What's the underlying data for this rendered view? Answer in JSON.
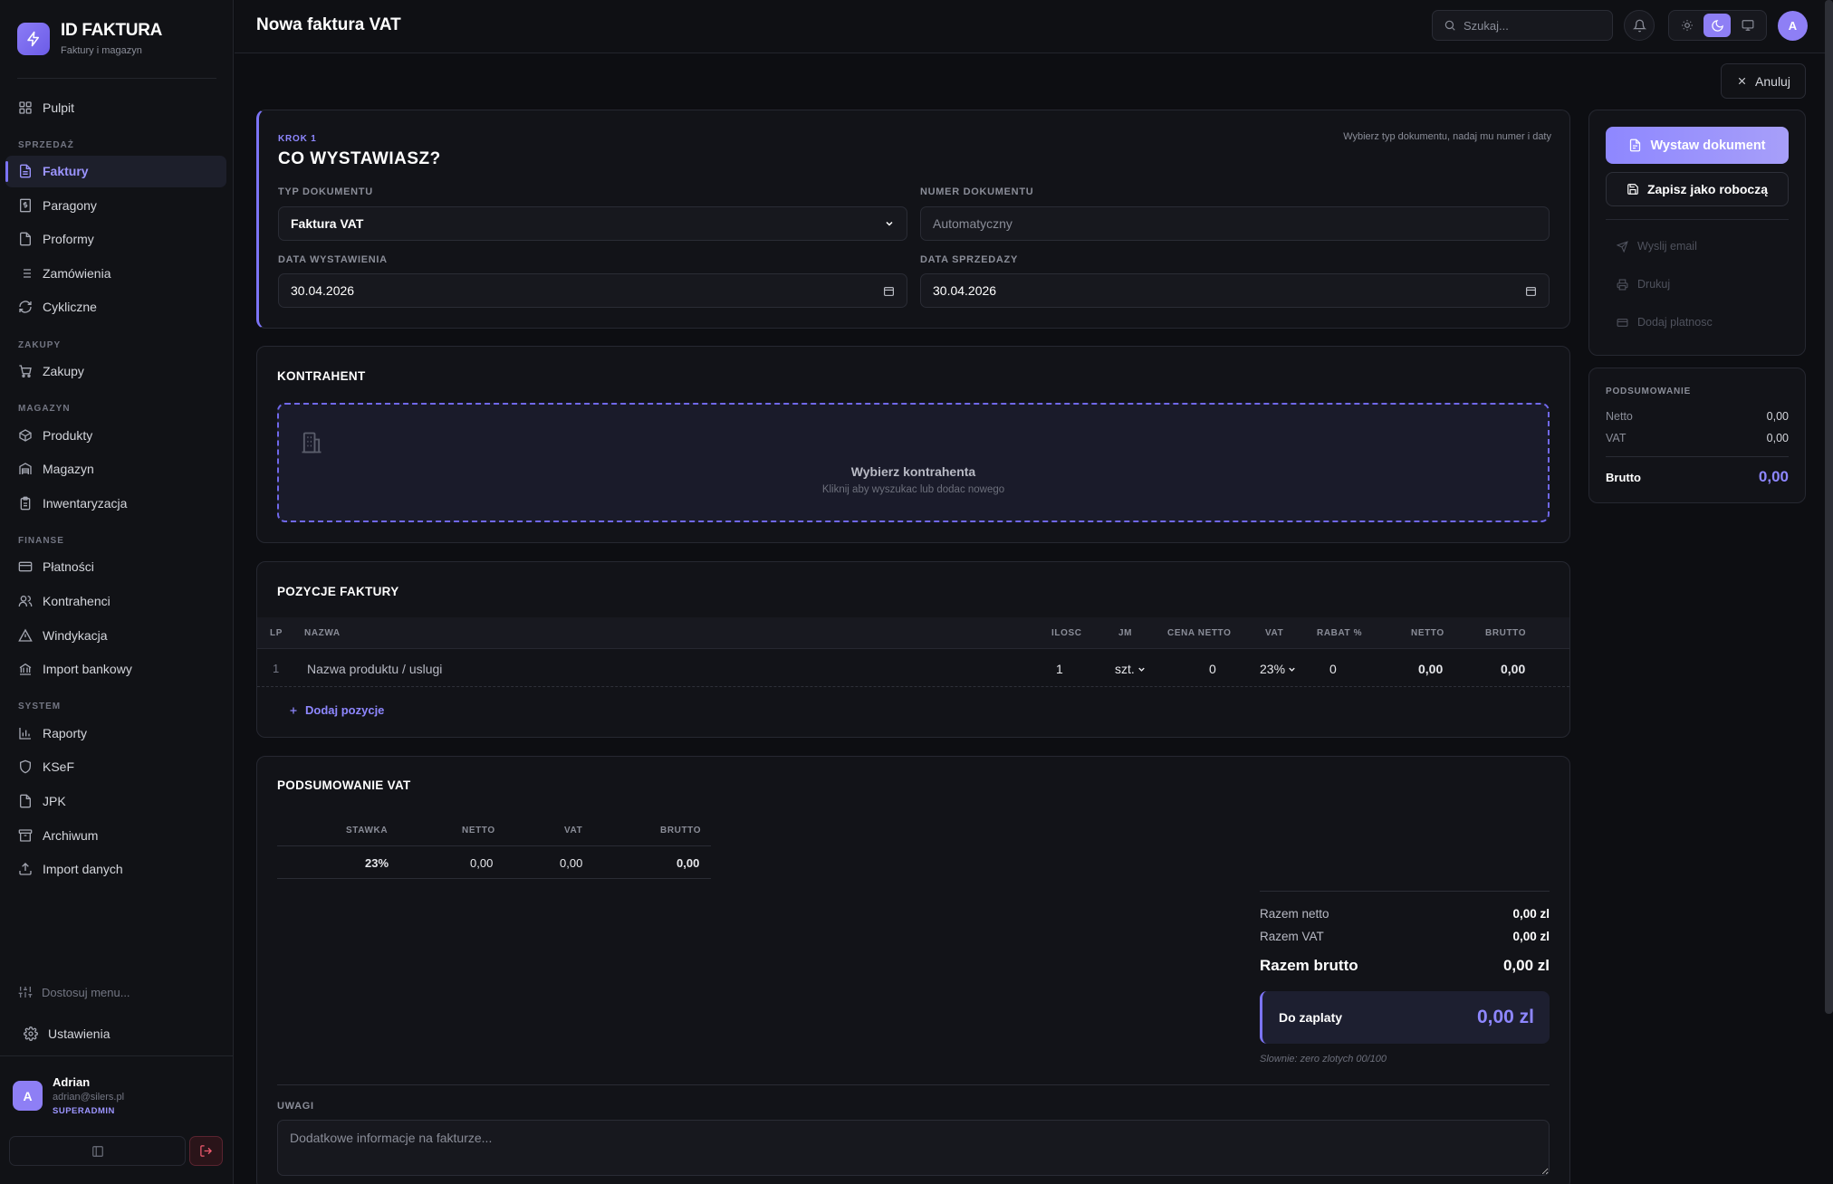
{
  "brand": {
    "title": "ID FAKTURA",
    "subtitle": "Faktury i magazyn"
  },
  "nav": {
    "dashboard": "Pulpit",
    "sections": {
      "sales": "SPRZEDAŻ",
      "purchases": "ZAKUPY",
      "warehouse": "MAGAZYN",
      "finance": "FINANSE",
      "system": "SYSTEM"
    },
    "items": {
      "invoices": "Faktury",
      "receipts": "Paragony",
      "proformas": "Proformy",
      "orders": "Zamówienia",
      "recurring": "Cykliczne",
      "purchases": "Zakupy",
      "products": "Produkty",
      "warehouse": "Magazyn",
      "inventory": "Inwentaryzacja",
      "payments": "Płatności",
      "contractors": "Kontrahenci",
      "collection": "Windykacja",
      "bank_import": "Import bankowy",
      "reports": "Raporty",
      "ksef": "KSeF",
      "jpk": "JPK",
      "archive": "Archiwum",
      "data_import": "Import danych"
    },
    "customize": "Dostosuj menu...",
    "settings": "Ustawienia"
  },
  "user": {
    "initial": "A",
    "name": "Adrian",
    "email": "adrian@silers.pl",
    "role": "SUPERADMIN"
  },
  "topbar": {
    "title": "Nowa faktura VAT",
    "search_placeholder": "Szukaj...",
    "avatar_initial": "A"
  },
  "cancel_label": "Anuluj",
  "step": {
    "tag": "KROK 1",
    "title": "CO WYSTAWIASZ?",
    "hint": "Wybierz typ dokumentu, nadaj mu numer i daty",
    "doc_type_label": "TYP DOKUMENTU",
    "doc_type_value": "Faktura VAT",
    "doc_number_label": "NUMER DOKUMENTU",
    "doc_number_placeholder": "Automatyczny",
    "issue_date_label": "DATA WYSTAWIENIA",
    "issue_date_value": "30.04.2026",
    "sale_date_label": "DATA SPRZEDAZY",
    "sale_date_value": "30.04.2026"
  },
  "contractor": {
    "title": "KONTRAHENT",
    "drop_title": "Wybierz kontrahenta",
    "drop_subtitle": "Kliknij aby wyszukac lub dodac nowego"
  },
  "positions": {
    "title": "POZYCJE FAKTURY",
    "columns": {
      "lp": "LP",
      "name": "NAZWA",
      "qty": "ILOSC",
      "unit": "JM",
      "net_price": "CENA NETTO",
      "vat": "VAT",
      "discount": "RABAT %",
      "net": "NETTO",
      "gross": "BRUTTO"
    },
    "rows": [
      {
        "lp": "1",
        "name_placeholder": "Nazwa produktu / uslugi",
        "qty": "1",
        "unit": "szt.",
        "net_price": "0",
        "vat": "23%",
        "discount": "0",
        "net": "0,00",
        "gross": "0,00"
      }
    ],
    "add_label": "Dodaj pozycje"
  },
  "vat_summary": {
    "title": "PODSUMOWANIE VAT",
    "columns": {
      "rate": "STAWKA",
      "net": "NETTO",
      "vat": "VAT",
      "gross": "BRUTTO"
    },
    "rows": [
      {
        "rate": "23%",
        "net": "0,00",
        "vat": "0,00",
        "gross": "0,00"
      }
    ],
    "total_net_label": "Razem netto",
    "total_net_value": "0,00 zl",
    "total_vat_label": "Razem VAT",
    "total_vat_value": "0,00 zl",
    "total_gross_label": "Razem brutto",
    "total_gross_value": "0,00 zl",
    "due_label": "Do zaplaty",
    "due_value": "0,00 zl",
    "in_words": "Slownie: zero zlotych 00/100",
    "notes_label": "UWAGI",
    "notes_placeholder": "Dodatkowe informacje na fakturze..."
  },
  "actions": {
    "issue": "Wystaw dokument",
    "save_draft": "Zapisz jako roboczą",
    "send_email": "Wyslij email",
    "print": "Drukuj",
    "add_payment": "Dodaj platnosc"
  },
  "summary": {
    "title": "PODSUMOWANIE",
    "net_label": "Netto",
    "net_value": "0,00",
    "vat_label": "VAT",
    "vat_value": "0,00",
    "gross_label": "Brutto",
    "gross_value": "0,00"
  },
  "colors": {
    "accent": "#8e87ff",
    "background": "#0d0e12",
    "card": "#121318",
    "danger": "#f05a6e"
  }
}
